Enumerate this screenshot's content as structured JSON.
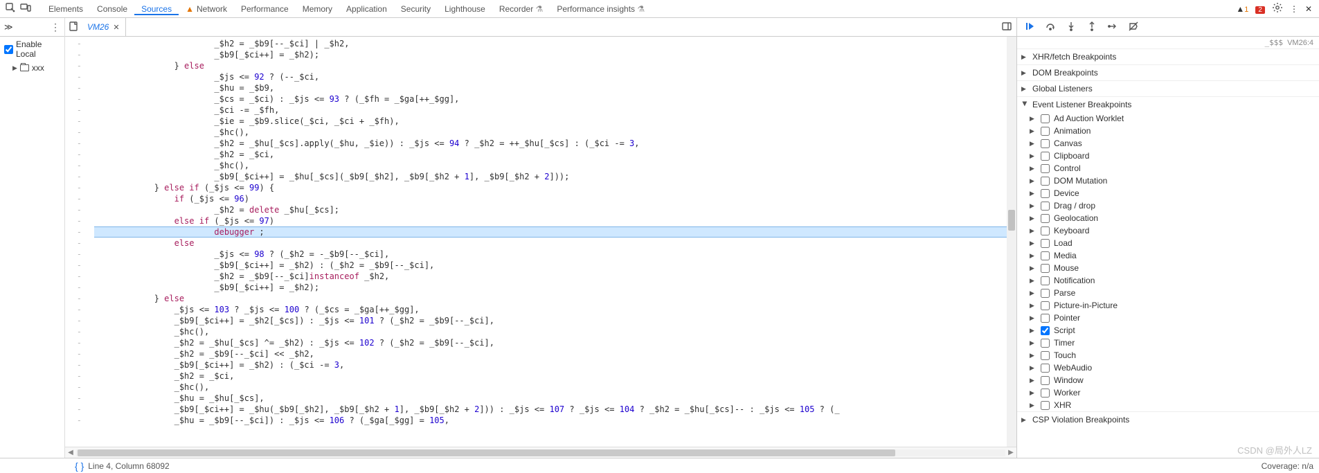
{
  "tabs": {
    "items": [
      "Elements",
      "Console",
      "Sources",
      "Network",
      "Performance",
      "Memory",
      "Application",
      "Security",
      "Lighthouse",
      "Recorder",
      "Performance insights"
    ],
    "active": "Sources",
    "network_has_warning": true,
    "flask_tabs": [
      "Recorder",
      "Performance insights"
    ]
  },
  "top_right": {
    "warning_count": "1",
    "error_count": "2"
  },
  "left": {
    "enable_local": "Enable Local",
    "enable_local_checked": true,
    "folder": "xxx"
  },
  "editor": {
    "tab_name": "VM26",
    "gutter_char": "-",
    "highlight_index": 17,
    "code_lines": [
      {
        "ind": 24,
        "t": "_$h2 = _$b9[--_$ci] | _$h2,"
      },
      {
        "ind": 24,
        "t": "_$b9[_$ci++] = _$h2);"
      },
      {
        "ind": 16,
        "t": "} <kw>else</kw>"
      },
      {
        "ind": 24,
        "t": "_$js <= <num>92</num> ? (--_$ci,"
      },
      {
        "ind": 24,
        "t": "_$hu = _$b9,"
      },
      {
        "ind": 24,
        "t": "_$cs = _$ci) : _$js <= <num>93</num> ? (_$fh = _$ga[++_$gg],"
      },
      {
        "ind": 24,
        "t": "_$ci -= _$fh,"
      },
      {
        "ind": 24,
        "t": "_$ie = _$b9.slice(_$ci, _$ci + _$fh),"
      },
      {
        "ind": 24,
        "t": "_$hc(),"
      },
      {
        "ind": 24,
        "t": "_$h2 = _$hu[_$cs].apply(_$hu, _$ie)) : _$js <= <num>94</num> ? _$h2 = ++_$hu[_$cs] : (_$ci -= <num>3</num>,"
      },
      {
        "ind": 24,
        "t": "_$h2 = _$ci,"
      },
      {
        "ind": 24,
        "t": "_$hc(),"
      },
      {
        "ind": 24,
        "t": "_$b9[_$ci++] = _$hu[_$cs](_$b9[_$h2], _$b9[_$h2 + <num>1</num>], _$b9[_$h2 + <num>2</num>]));"
      },
      {
        "ind": 12,
        "t": "} <kw>else if</kw> (_$js <= <num>99</num>) {"
      },
      {
        "ind": 16,
        "t": "<kw>if</kw> (_$js <= <num>96</num>)"
      },
      {
        "ind": 24,
        "t": "_$h2 = <kw>delete</kw> _$hu[_$cs];"
      },
      {
        "ind": 16,
        "t": "<kw>else if</kw> (_$js <= <num>97</num>)"
      },
      {
        "ind": 24,
        "t": "<kw>debugger</kw> ;"
      },
      {
        "ind": 16,
        "t": "<kw>else</kw>"
      },
      {
        "ind": 24,
        "t": "_$js <= <num>98</num> ? (_$h2 = -_$b9[--_$ci],"
      },
      {
        "ind": 24,
        "t": "_$b9[_$ci++] = _$h2) : (_$h2 = _$b9[--_$ci],"
      },
      {
        "ind": 24,
        "t": "_$h2 = _$b9[--_$ci]<kw>instanceof</kw> _$h2,"
      },
      {
        "ind": 24,
        "t": "_$b9[_$ci++] = _$h2);"
      },
      {
        "ind": 12,
        "t": "} <kw>else</kw>"
      },
      {
        "ind": 16,
        "t": "_$js <= <num>103</num> ? _$js <= <num>100</num> ? (_$cs = _$ga[++_$gg],"
      },
      {
        "ind": 16,
        "t": "_$b9[_$ci++] = _$h2[_$cs]) : _$js <= <num>101</num> ? (_$h2 = _$b9[--_$ci],"
      },
      {
        "ind": 16,
        "t": "_$hc(),"
      },
      {
        "ind": 16,
        "t": "_$h2 = _$hu[_$cs] ^= _$h2) : _$js <= <num>102</num> ? (_$h2 = _$b9[--_$ci],"
      },
      {
        "ind": 16,
        "t": "_$h2 = _$b9[--_$ci] << _$h2,"
      },
      {
        "ind": 16,
        "t": "_$b9[_$ci++] = _$h2) : (_$ci -= <num>3</num>,"
      },
      {
        "ind": 16,
        "t": "_$h2 = _$ci,"
      },
      {
        "ind": 16,
        "t": "_$hc(),"
      },
      {
        "ind": 16,
        "t": "_$hu = _$hu[_$cs],"
      },
      {
        "ind": 16,
        "t": "_$b9[_$ci++] = _$hu(_$b9[_$h2], _$b9[_$h2 + <num>1</num>], _$b9[_$h2 + <num>2</num>])) : _$js <= <num>107</num> ? _$js <= <num>104</num> ? _$h2 = _$hu[_$cs]-- : _$js <= <num>105</num> ? (_"
      },
      {
        "ind": 16,
        "t": "_$hu = _$b9[--_$ci]) : _$js <= <num>106</num> ? (_$ga[_$gg] = <num>105</num>,"
      }
    ]
  },
  "debugger": {
    "crumb_top": "_$$$",
    "crumb_loc": "VM26:4",
    "panes": [
      {
        "label": "XHR/fetch Breakpoints",
        "open": false
      },
      {
        "label": "DOM Breakpoints",
        "open": false
      },
      {
        "label": "Global Listeners",
        "open": false
      },
      {
        "label": "Event Listener Breakpoints",
        "open": true
      }
    ],
    "event_categories": [
      {
        "label": "Ad Auction Worklet",
        "checked": false
      },
      {
        "label": "Animation",
        "checked": false
      },
      {
        "label": "Canvas",
        "checked": false
      },
      {
        "label": "Clipboard",
        "checked": false
      },
      {
        "label": "Control",
        "checked": false
      },
      {
        "label": "DOM Mutation",
        "checked": false
      },
      {
        "label": "Device",
        "checked": false
      },
      {
        "label": "Drag / drop",
        "checked": false
      },
      {
        "label": "Geolocation",
        "checked": false
      },
      {
        "label": "Keyboard",
        "checked": false
      },
      {
        "label": "Load",
        "checked": false
      },
      {
        "label": "Media",
        "checked": false
      },
      {
        "label": "Mouse",
        "checked": false
      },
      {
        "label": "Notification",
        "checked": false
      },
      {
        "label": "Parse",
        "checked": false
      },
      {
        "label": "Picture-in-Picture",
        "checked": false
      },
      {
        "label": "Pointer",
        "checked": false
      },
      {
        "label": "Script",
        "checked": true
      },
      {
        "label": "Timer",
        "checked": false
      },
      {
        "label": "Touch",
        "checked": false
      },
      {
        "label": "WebAudio",
        "checked": false
      },
      {
        "label": "Window",
        "checked": false
      },
      {
        "label": "Worker",
        "checked": false
      },
      {
        "label": "XHR",
        "checked": false
      }
    ],
    "last_pane": "CSP Violation Breakpoints"
  },
  "status": {
    "cursor": "Line 4, Column 68092",
    "coverage": "Coverage: n/a"
  },
  "watermark": "CSDN @局外人LZ"
}
